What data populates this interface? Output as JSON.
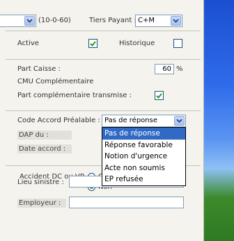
{
  "header": {
    "range_label": "(10-0-60)",
    "tiers_payant_label": "Tiers Payant :",
    "tiers_payant_value": "C+M"
  },
  "flags": {
    "active_label": "Active",
    "active_checked": true,
    "historique_label": "Historique",
    "historique_checked": false
  },
  "part": {
    "caisse_label": "Part Caisse :",
    "caisse_value": "60",
    "caisse_unit": "%",
    "cmu_label": "CMU Complémentaire",
    "transmise_label": "Part complémentaire transmise :",
    "transmise_checked": true
  },
  "accord": {
    "code_label": "Code Accord Préalable :",
    "code_value": "Pas de réponse",
    "dap_label": "DAP du :",
    "date_label": "Date accord :",
    "options": [
      "Pas de réponse",
      "Réponse favorable",
      "Notion d'urgence",
      "Acte non soumis",
      "EP refusée"
    ],
    "selected_index": 0
  },
  "accident": {
    "label": "Accident DC ou VP",
    "radio_oui_label": "O",
    "radio_non_label": "Non",
    "lieu_label": "Lieu sinistre :",
    "employeur_label": "Employeur :"
  },
  "colors": {
    "selection": "#316ac5",
    "check": "#21a121"
  }
}
